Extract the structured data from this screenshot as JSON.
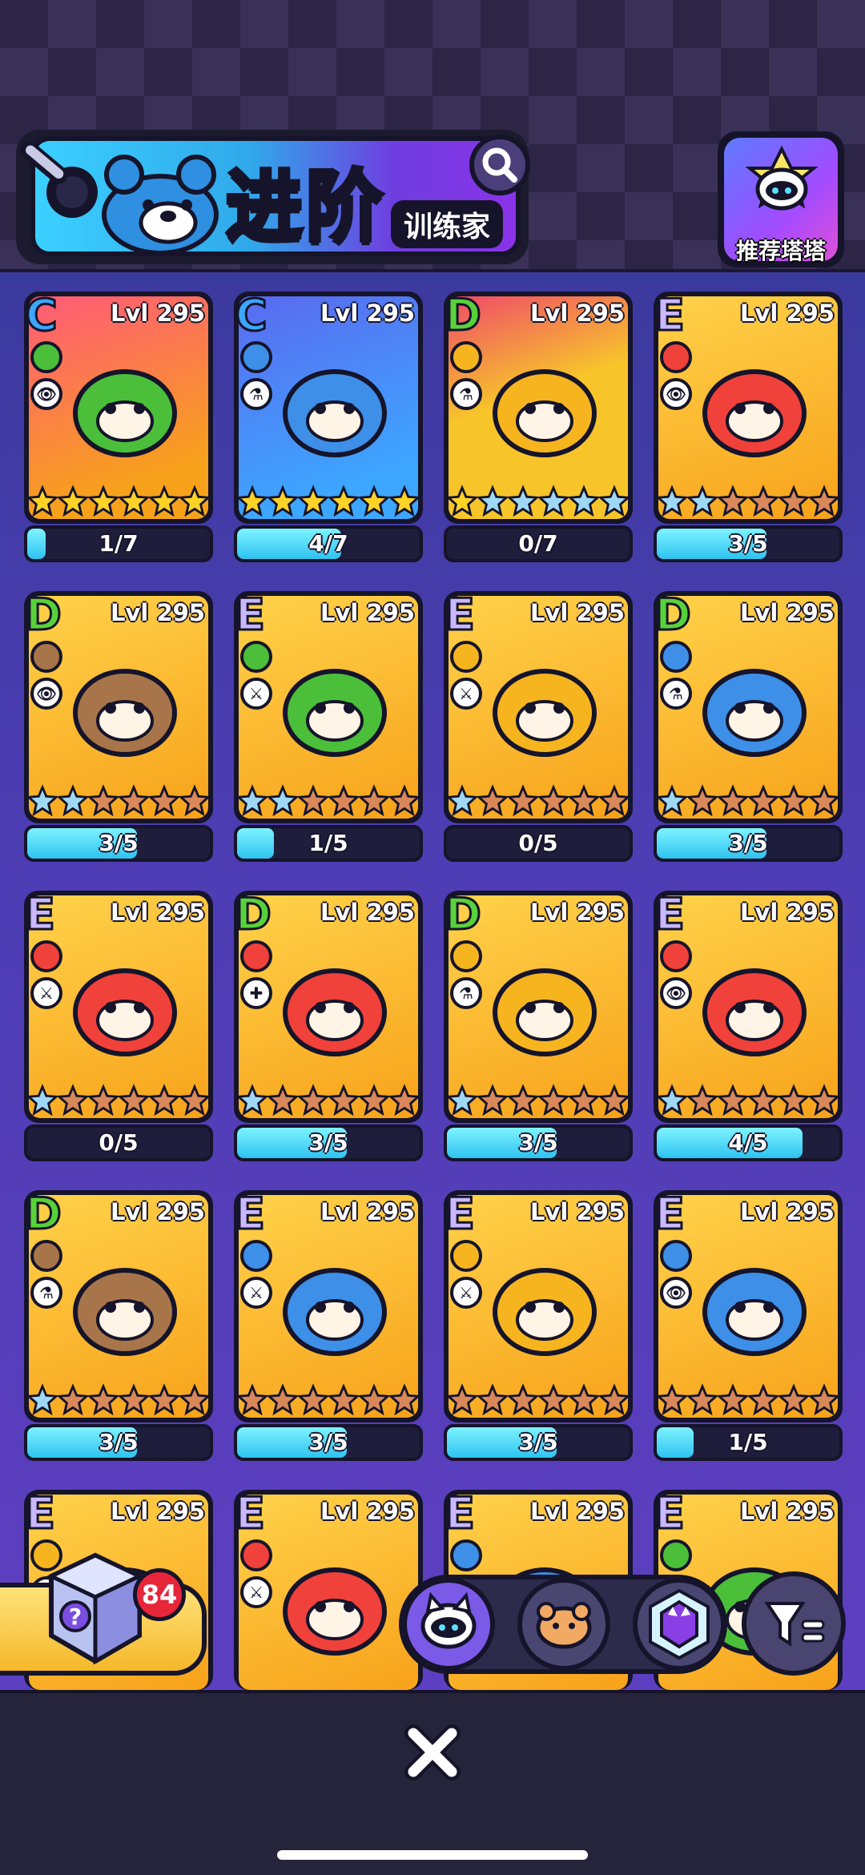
{
  "header": {
    "title": "进阶",
    "subtitle": "训练家",
    "recommend_label": "推荐塔塔"
  },
  "colors": {
    "fire": "#f0413a",
    "water": "#3d8fe8",
    "grass": "#4bbf3a",
    "electric": "#f6b51f",
    "earth": "#a8754a",
    "star_gold": "#ffd326",
    "star_blue": "#9fd8f5",
    "star_bronze": "#d9885a"
  },
  "cards": [
    {
      "grade": "C",
      "level": "Lvl 295",
      "element": "grass",
      "role": "👁",
      "art": "#f05a7a",
      "stars": [
        "gold",
        "gold",
        "gold",
        "gold",
        "gold",
        "gold"
      ],
      "progress": "1/7",
      "fill": 0.1
    },
    {
      "grade": "C",
      "level": "Lvl 295",
      "element": "water",
      "role": "⚗",
      "art": "#3d8fe8",
      "stars": [
        "gold",
        "gold",
        "gold",
        "gold",
        "gold",
        "gold"
      ],
      "progress": "4/7",
      "fill": 0.57
    },
    {
      "grade": "D",
      "level": "Lvl 295",
      "element": "electric",
      "role": "⚗",
      "art": "#f6b51f",
      "stars": [
        "gold",
        "blue",
        "blue",
        "blue",
        "blue",
        "blue"
      ],
      "progress": "0/7",
      "fill": 0
    },
    {
      "grade": "E",
      "level": "Lvl 295",
      "element": "fire",
      "role": "👁",
      "art": "#f6b51f",
      "stars": [
        "blue",
        "blue",
        "bronze",
        "bronze",
        "bronze",
        "bronze"
      ],
      "progress": "3/5",
      "fill": 0.6
    },
    {
      "grade": "D",
      "level": "Lvl 295",
      "element": "earth",
      "role": "👁",
      "art": "#f6b51f",
      "stars": [
        "blue",
        "blue",
        "bronze",
        "bronze",
        "bronze",
        "bronze"
      ],
      "progress": "3/5",
      "fill": 0.6
    },
    {
      "grade": "E",
      "level": "Lvl 295",
      "element": "grass",
      "role": "⚔",
      "art": "#f6b51f",
      "stars": [
        "blue",
        "blue",
        "bronze",
        "bronze",
        "bronze",
        "bronze"
      ],
      "progress": "1/5",
      "fill": 0.2
    },
    {
      "grade": "E",
      "level": "Lvl 295",
      "element": "electric",
      "role": "⚔",
      "art": "#f6b51f",
      "stars": [
        "blue",
        "bronze",
        "bronze",
        "bronze",
        "bronze",
        "bronze"
      ],
      "progress": "0/5",
      "fill": 0
    },
    {
      "grade": "D",
      "level": "Lvl 295",
      "element": "water",
      "role": "⚗",
      "art": "#f6b51f",
      "stars": [
        "blue",
        "bronze",
        "bronze",
        "bronze",
        "bronze",
        "bronze"
      ],
      "progress": "3/5",
      "fill": 0.6
    },
    {
      "grade": "E",
      "level": "Lvl 295",
      "element": "fire",
      "role": "⚔",
      "art": "#f6b51f",
      "stars": [
        "blue",
        "bronze",
        "bronze",
        "bronze",
        "bronze",
        "bronze"
      ],
      "progress": "0/5",
      "fill": 0
    },
    {
      "grade": "D",
      "level": "Lvl 295",
      "element": "fire",
      "role": "✚",
      "art": "#f6b51f",
      "stars": [
        "blue",
        "bronze",
        "bronze",
        "bronze",
        "bronze",
        "bronze"
      ],
      "progress": "3/5",
      "fill": 0.6
    },
    {
      "grade": "D",
      "level": "Lvl 295",
      "element": "electric",
      "role": "⚗",
      "art": "#f6b51f",
      "stars": [
        "blue",
        "bronze",
        "bronze",
        "bronze",
        "bronze",
        "bronze"
      ],
      "progress": "3/5",
      "fill": 0.6
    },
    {
      "grade": "E",
      "level": "Lvl 295",
      "element": "fire",
      "role": "👁",
      "art": "#f6b51f",
      "stars": [
        "blue",
        "bronze",
        "bronze",
        "bronze",
        "bronze",
        "bronze"
      ],
      "progress": "4/5",
      "fill": 0.8
    },
    {
      "grade": "D",
      "level": "Lvl 295",
      "element": "earth",
      "role": "⚗",
      "art": "#f6b51f",
      "stars": [
        "blue",
        "bronze",
        "bronze",
        "bronze",
        "bronze",
        "bronze"
      ],
      "progress": "3/5",
      "fill": 0.6
    },
    {
      "grade": "E",
      "level": "Lvl 295",
      "element": "water",
      "role": "⚔",
      "art": "#f6b51f",
      "stars": [
        "bronze",
        "bronze",
        "bronze",
        "bronze",
        "bronze",
        "bronze"
      ],
      "progress": "3/5",
      "fill": 0.6
    },
    {
      "grade": "E",
      "level": "Lvl 295",
      "element": "electric",
      "role": "⚔",
      "art": "#f6b51f",
      "stars": [
        "bronze",
        "bronze",
        "bronze",
        "bronze",
        "bronze",
        "bronze"
      ],
      "progress": "3/5",
      "fill": 0.6
    },
    {
      "grade": "E",
      "level": "Lvl 295",
      "element": "water",
      "role": "👁",
      "art": "#f6b51f",
      "stars": [
        "bronze",
        "bronze",
        "bronze",
        "bronze",
        "bronze",
        "bronze"
      ],
      "progress": "1/5",
      "fill": 0.2
    },
    {
      "grade": "E",
      "level": "Lvl 295",
      "element": "electric",
      "role": "⚔",
      "art": "#f6b51f",
      "stars": [],
      "progress": "",
      "fill": 0
    },
    {
      "grade": "E",
      "level": "Lvl 295",
      "element": "fire",
      "role": "⚔",
      "art": "#f6b51f",
      "stars": [],
      "progress": "",
      "fill": 0
    },
    {
      "grade": "E",
      "level": "Lvl 295",
      "element": "water",
      "role": "⚔",
      "art": "#f6b51f",
      "stars": [],
      "progress": "",
      "fill": 0
    },
    {
      "grade": "E",
      "level": "Lvl 295",
      "element": "grass",
      "role": "⚔",
      "art": "#f6b51f",
      "stars": [],
      "progress": "",
      "fill": 0
    }
  ],
  "chest": {
    "count": "84"
  },
  "filters": [
    {
      "name": "filter-all",
      "active": true
    },
    {
      "name": "filter-bread",
      "active": false
    },
    {
      "name": "filter-rare",
      "active": false
    }
  ]
}
